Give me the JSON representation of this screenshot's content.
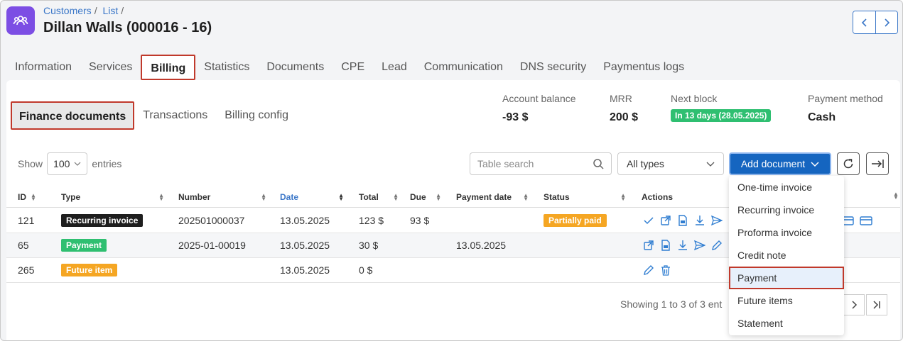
{
  "breadcrumb": {
    "items": [
      "Customers",
      "List"
    ],
    "sep": "/"
  },
  "title": "Dillan Walls (000016 - 16)",
  "top_tabs": [
    "Information",
    "Services",
    "Billing",
    "Statistics",
    "Documents",
    "CPE",
    "Lead",
    "Communication",
    "DNS security",
    "Paymentus logs"
  ],
  "sub_tabs": [
    "Finance documents",
    "Transactions",
    "Billing config"
  ],
  "stats": {
    "balance_label": "Account balance",
    "balance_value": "-93 $",
    "mrr_label": "MRR",
    "mrr_value": "200 $",
    "next_label": "Next block",
    "next_value": "In 13 days (28.05.2025)",
    "pay_label": "Payment method",
    "pay_value": "Cash"
  },
  "controls": {
    "show": "Show",
    "entries_value": "100",
    "entries": "entries",
    "search_placeholder": "Table search",
    "types_value": "All types",
    "add_document": "Add document"
  },
  "table": {
    "headers": [
      "ID",
      "Type",
      "Number",
      "Date",
      "Total",
      "Due",
      "Payment date",
      "Status",
      "Actions"
    ],
    "rows": [
      {
        "id": "121",
        "type": "Recurring invoice",
        "type_color": "#1e1e1e",
        "number": "202501000037",
        "date": "13.05.2025",
        "total": "123 $",
        "due": "93 $",
        "payment_date": "",
        "status": "Partially paid",
        "status_color": "#f5a623"
      },
      {
        "id": "65",
        "type": "Payment",
        "type_color": "#2fbf71",
        "number": "2025-01-00019",
        "date": "13.05.2025",
        "total": "30 $",
        "due": "",
        "payment_date": "13.05.2025",
        "status": "",
        "status_color": ""
      },
      {
        "id": "265",
        "type": "Future item",
        "type_color": "#f5a623",
        "number": "",
        "date": "13.05.2025",
        "total": "0 $",
        "due": "",
        "payment_date": "",
        "status": "",
        "status_color": ""
      }
    ],
    "footer": "Showing 1 to 3 of 3 ent"
  },
  "dropdown": [
    "One-time invoice",
    "Recurring invoice",
    "Proforma invoice",
    "Credit note",
    "Payment",
    "Future items",
    "Statement"
  ],
  "colors": {
    "accent": "#1565c0",
    "highlight_border": "#c0392b",
    "app_icon": "#7c4ee4",
    "link": "#3b77c8"
  },
  "icons": [
    "users-icon",
    "chevron-left-icon",
    "chevron-right-icon",
    "search-icon",
    "refresh-icon",
    "export-icon",
    "check-icon",
    "external-link-icon",
    "pdf-icon",
    "download-icon",
    "send-icon",
    "edit-icon",
    "trash-icon",
    "card-icon"
  ]
}
